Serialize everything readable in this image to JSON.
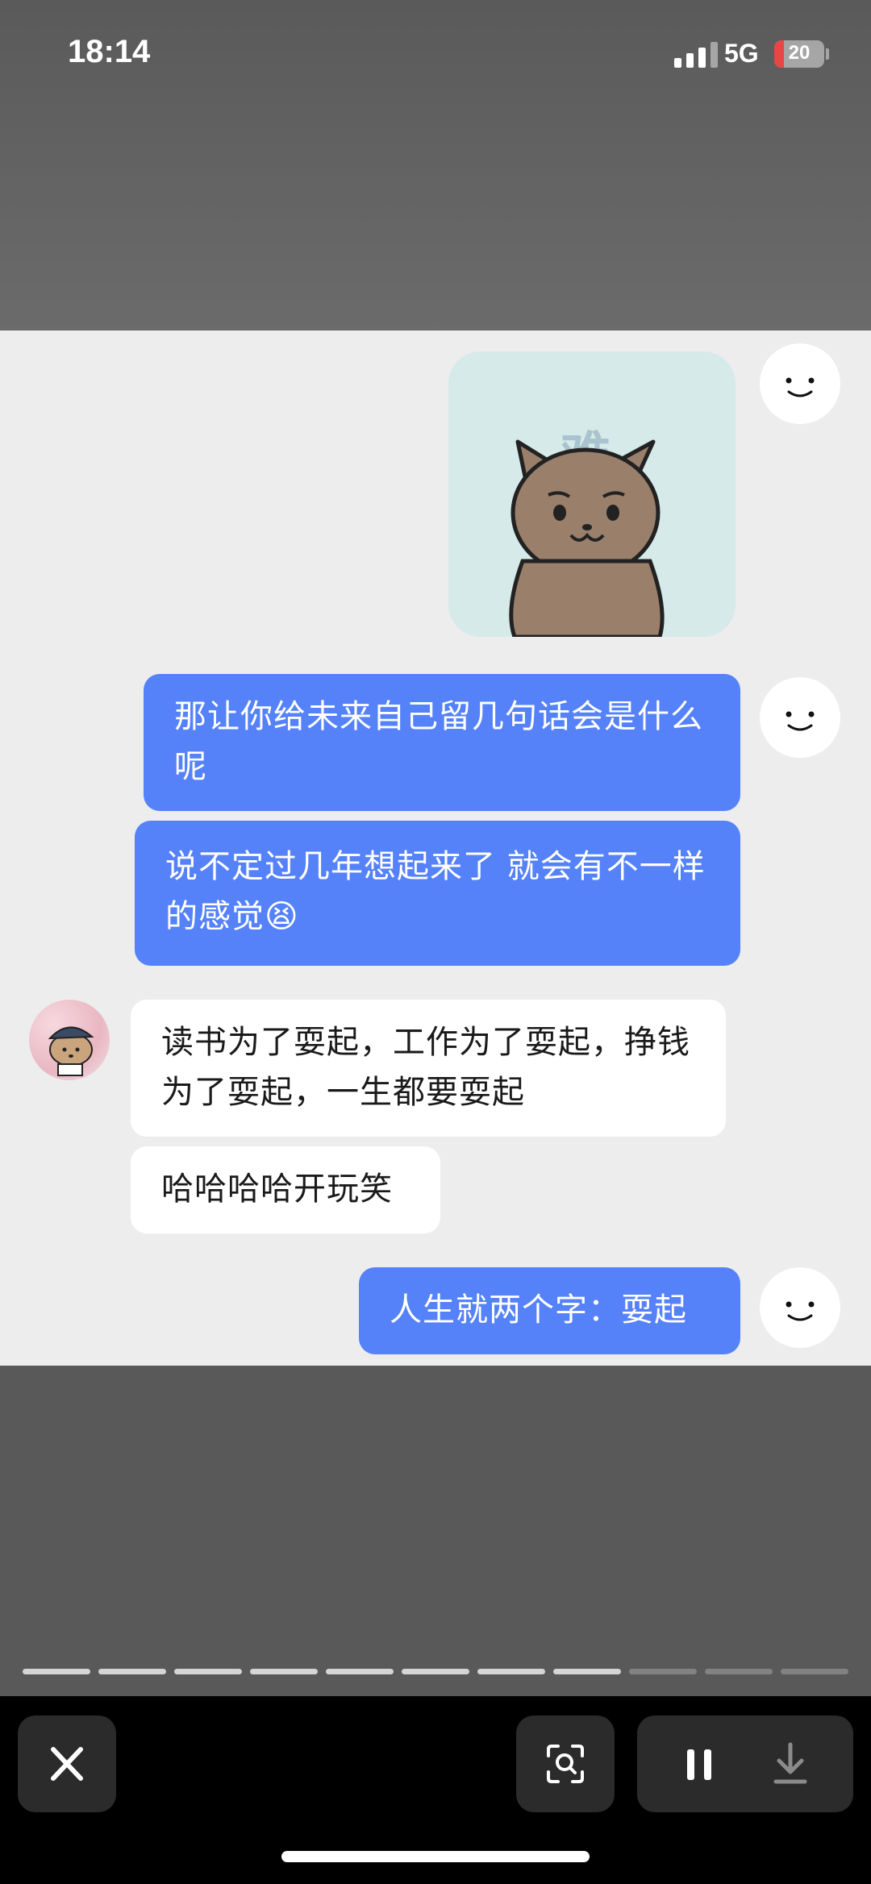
{
  "status_bar": {
    "time": "18:14",
    "network": "5G",
    "battery_level": "20",
    "battery_fraction": 0.2,
    "signal_bars_active": 3,
    "signal_bars_total": 4
  },
  "chat": {
    "sticker": {
      "icon": "cat-sticker-icon",
      "caption": "难"
    },
    "messages": [
      {
        "side": "me",
        "text": "那让你给未来自己留几句话会是什么呢"
      },
      {
        "side": "me",
        "text": "说不定过几年想起来了 就会有不一样的感觉😫"
      },
      {
        "side": "other",
        "text": "读书为了耍起，工作为了耍起，挣钱为了耍起，一生都要耍起"
      },
      {
        "side": "other",
        "text": "哈哈哈哈开玩笑"
      },
      {
        "side": "me",
        "text": "人生就两个字：耍起"
      }
    ],
    "colors": {
      "my_bubble": "#5582f8",
      "their_bubble": "#ffffff",
      "background": "#ededed"
    }
  },
  "story_progress": {
    "segments_total": 11,
    "segments_done": 8
  },
  "toolbar": {
    "close_icon": "close-icon",
    "scan_icon": "scan-icon",
    "pause_icon": "pause-icon",
    "download_icon": "download-icon"
  }
}
